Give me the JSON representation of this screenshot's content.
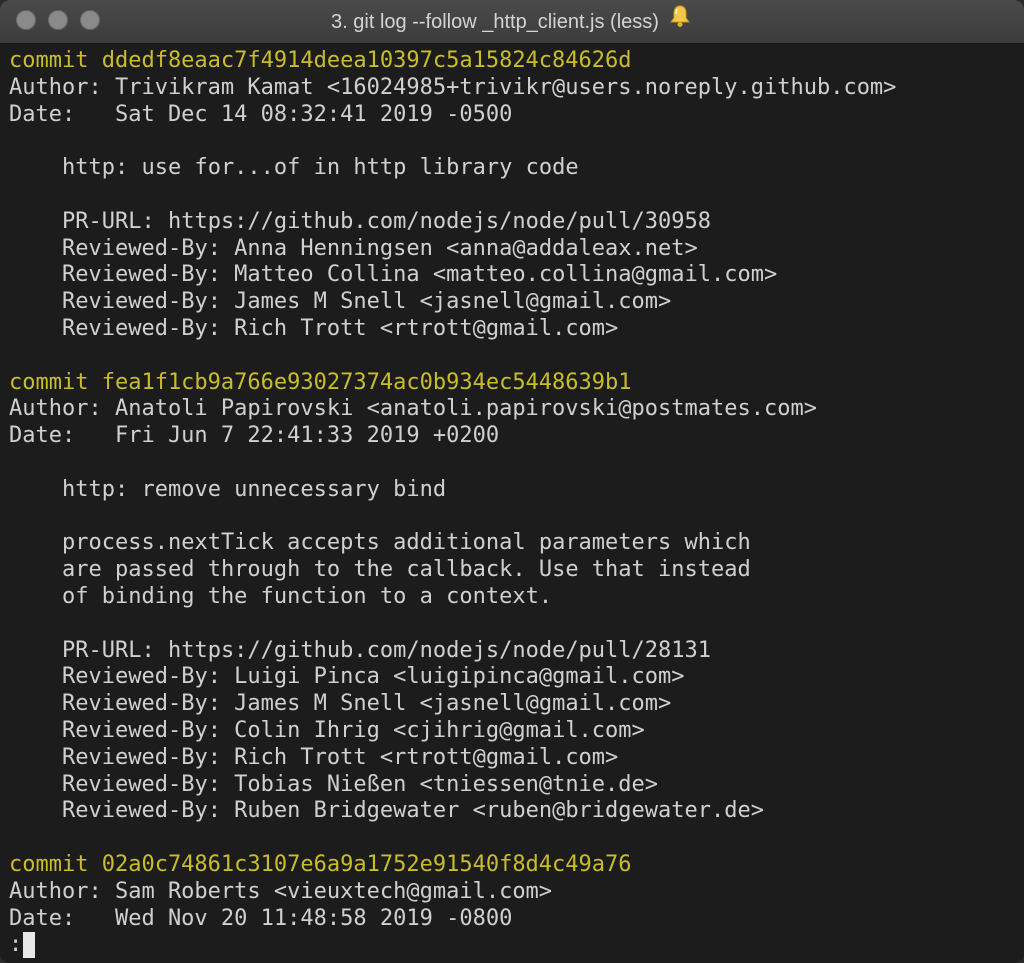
{
  "window": {
    "title": "3. git log --follow _http_client.js (less)",
    "title_icon": "bell-icon"
  },
  "colors": {
    "commit": "#c9bd2a",
    "text": "#d0d0d0",
    "background": "#1c1c1c"
  },
  "commits": [
    {
      "commit": "commit ddedf8eaac7f4914deea10397c5a15824c84626d",
      "author": "Author: Trivikram Kamat <16024985+trivikr@users.noreply.github.com>",
      "date": "Date:   Sat Dec 14 08:32:41 2019 -0500",
      "subject": "http: use for...of in http library code",
      "body": [],
      "pr_url": "PR-URL: https://github.com/nodejs/node/pull/30958",
      "reviewers": [
        "Reviewed-By: Anna Henningsen <anna@addaleax.net>",
        "Reviewed-By: Matteo Collina <matteo.collina@gmail.com>",
        "Reviewed-By: James M Snell <jasnell@gmail.com>",
        "Reviewed-By: Rich Trott <rtrott@gmail.com>"
      ]
    },
    {
      "commit": "commit fea1f1cb9a766e93027374ac0b934ec5448639b1",
      "author": "Author: Anatoli Papirovski <anatoli.papirovski@postmates.com>",
      "date": "Date:   Fri Jun 7 22:41:33 2019 +0200",
      "subject": "http: remove unnecessary bind",
      "body": [
        "process.nextTick accepts additional parameters which",
        "are passed through to the callback. Use that instead",
        "of binding the function to a context."
      ],
      "pr_url": "PR-URL: https://github.com/nodejs/node/pull/28131",
      "reviewers": [
        "Reviewed-By: Luigi Pinca <luigipinca@gmail.com>",
        "Reviewed-By: James M Snell <jasnell@gmail.com>",
        "Reviewed-By: Colin Ihrig <cjihrig@gmail.com>",
        "Reviewed-By: Rich Trott <rtrott@gmail.com>",
        "Reviewed-By: Tobias Nießen <tniessen@tnie.de>",
        "Reviewed-By: Ruben Bridgewater <ruben@bridgewater.de>"
      ]
    }
  ],
  "last_commit": {
    "commit": "commit 02a0c74861c3107e6a9a1752e91540f8d4c49a76",
    "author": "Author: Sam Roberts <vieuxtech@gmail.com>",
    "date": "Date:   Wed Nov 20 11:48:58 2019 -0800"
  },
  "prompt": ":"
}
